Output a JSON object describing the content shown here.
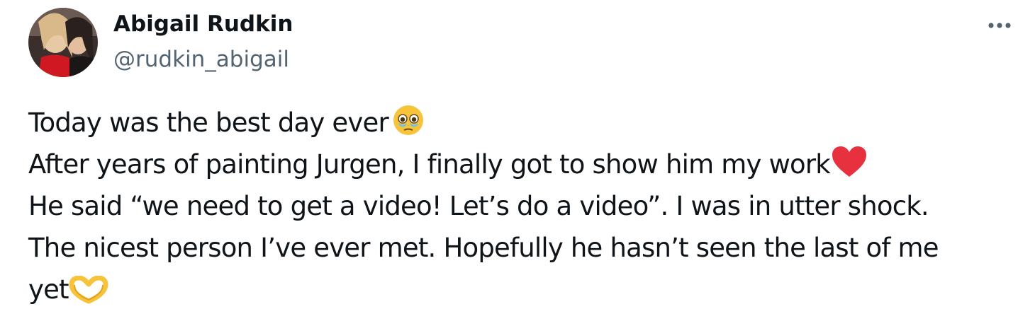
{
  "author": {
    "display_name": "Abigail Rudkin",
    "handle": "@rudkin_abigail",
    "avatar_icon": "user-avatar-photo"
  },
  "actions": {
    "more_icon": "more-horizontal-icon"
  },
  "tweet": {
    "lines": [
      {
        "text": "Today was the best day ever",
        "emoji": "face-holding-back-tears"
      },
      {
        "text": "After years of painting Jurgen, I finally got to show him my work",
        "emoji": "red-heart"
      },
      {
        "text": "He said “we need to get a video! Let’s do a video”. I was in utter shock."
      },
      {
        "text": "The nicest person I’ve ever met. Hopefully he hasn’t seen the last of me"
      },
      {
        "text": "yet",
        "emoji": "heart-hands"
      }
    ]
  },
  "colors": {
    "text": "#0f1419",
    "secondary": "#536471",
    "link": "#1d9bf0",
    "heart": "#e8313f",
    "emoji_yellow": "#f7c33b"
  }
}
